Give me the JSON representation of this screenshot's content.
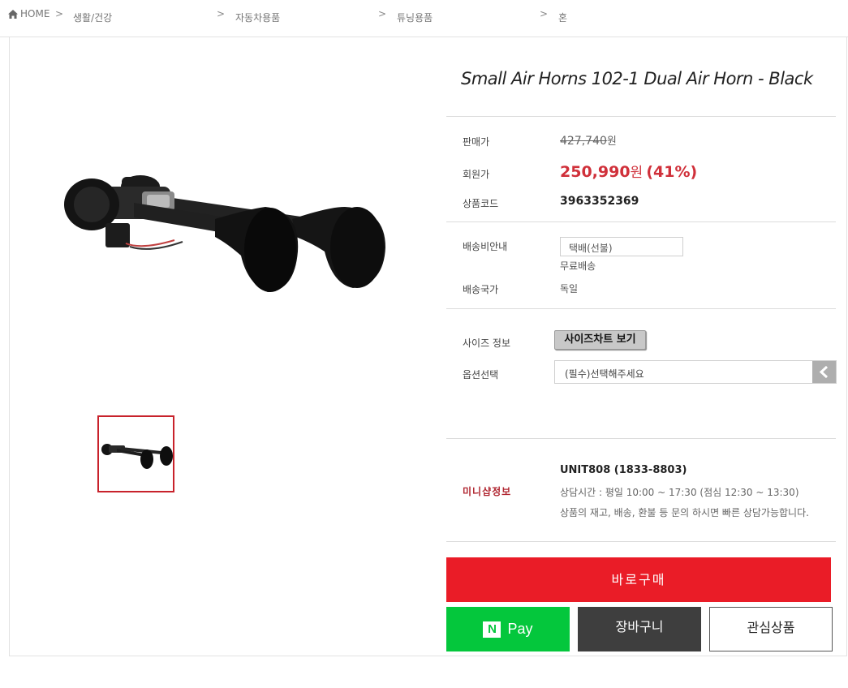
{
  "breadcrumb": {
    "home": "HOME",
    "separator": ">",
    "items": [
      "생활/건강",
      "자동차용품",
      "튜닝용품",
      "혼"
    ]
  },
  "product": {
    "title": "Small Air Horns 102-1 Dual Air Horn - Black",
    "image_alt": "dual black air horn",
    "price_label": "판매가",
    "original_price": "427,740",
    "original_price_unit": "원",
    "member_label": "회원가",
    "member_price": "250,990",
    "member_price_unit": "원",
    "discount": "(41%)",
    "code_label": "상품코드",
    "code": "3963352369"
  },
  "shipping": {
    "fee_label": "배송비안내",
    "method": "택배(선불)",
    "fee_text": "무료배송",
    "country_label": "배송국가",
    "country": "독일"
  },
  "options": {
    "size_label": "사이즈 정보",
    "size_button": "사이즈차트 보기",
    "select_label": "옵션선택",
    "select_placeholder": "(필수)선택해주세요"
  },
  "mini_shop": {
    "label": "미니샵정보",
    "name": "UNIT808 (1833-8803)",
    "hours": "상담시간 : 평일 10:00 ~ 17:30 (점심 12:30 ~ 13:30)",
    "note": "상품의 재고, 배송, 환불 등 문의 하시면 빠른 상담가능합니다."
  },
  "actions": {
    "buy": "바로구매",
    "npay_logo": "N",
    "npay": "Pay",
    "cart": "장바구니",
    "wish": "관심상품"
  },
  "colors": {
    "buy": "#ea1c27",
    "npay": "#04c73c",
    "cart": "#3e3e3e",
    "price": "#d0303a",
    "mini_label": "#b02630"
  },
  "icons": {
    "home": "home-icon",
    "option_arrow": "chevron-left-icon"
  }
}
